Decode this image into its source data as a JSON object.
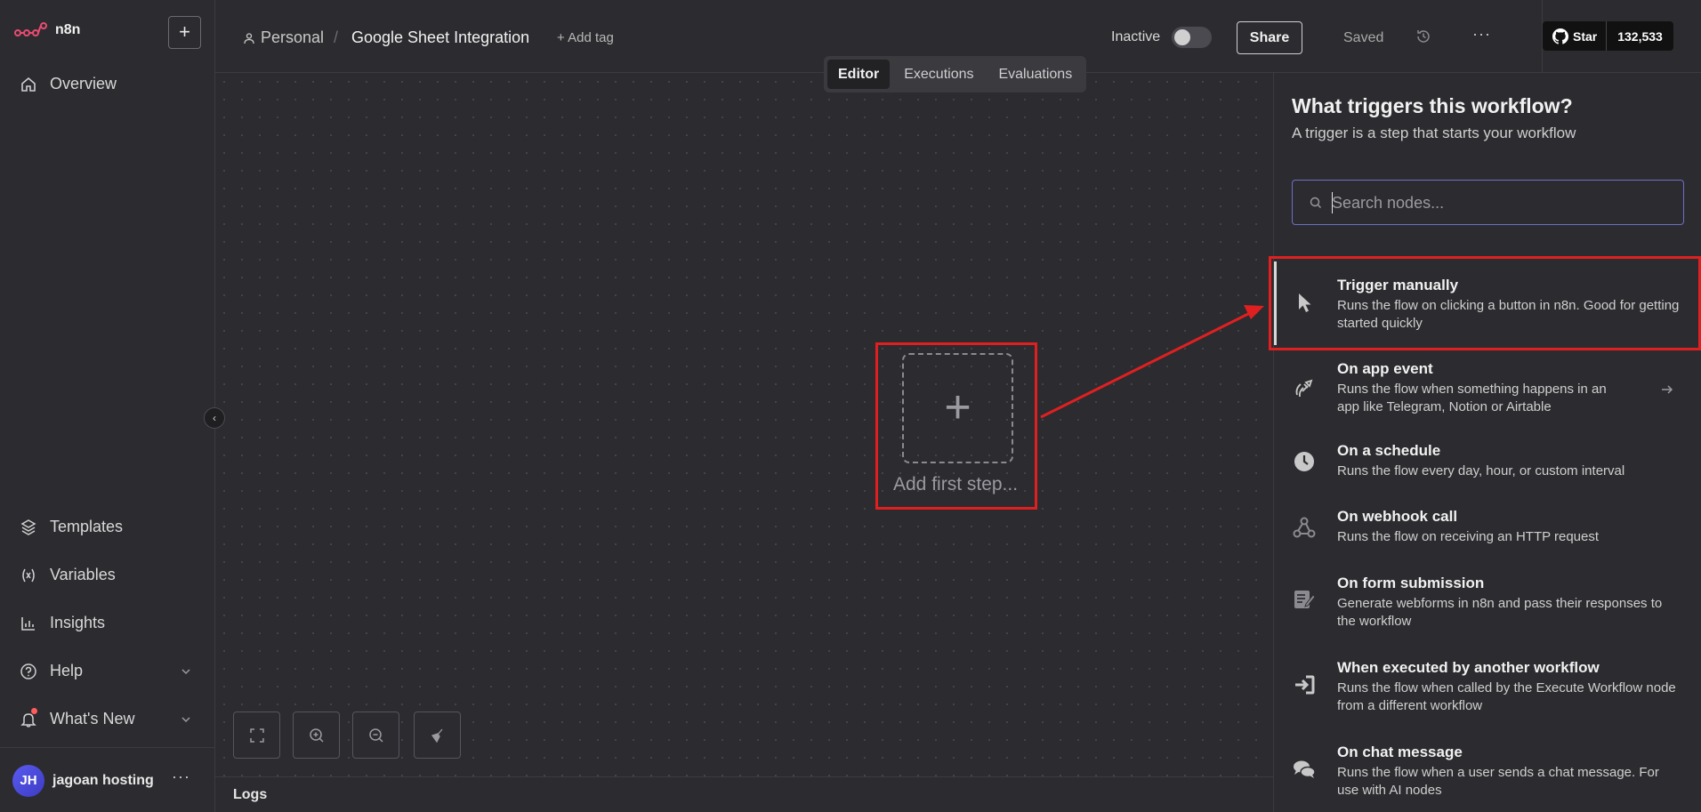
{
  "app": {
    "logo_text": "n8n",
    "new_button": "+"
  },
  "sidebar": {
    "items": [
      {
        "label": "Overview",
        "icon": "home-icon"
      },
      {
        "label": "Templates",
        "icon": "templates-icon"
      },
      {
        "label": "Variables",
        "icon": "variables-icon"
      },
      {
        "label": "Insights",
        "icon": "insights-icon"
      },
      {
        "label": "Help",
        "icon": "help-icon"
      },
      {
        "label": "What's New",
        "icon": "bell-icon"
      }
    ],
    "collapse_glyph": "‹",
    "user": {
      "initials": "JH",
      "name": "jagoan hosting",
      "more": "···"
    }
  },
  "header": {
    "breadcrumb_project": "Personal",
    "breadcrumb_sep": "/",
    "workflow_title": "Google Sheet Integration",
    "add_tag": "+ Add tag",
    "active_label": "Inactive",
    "share": "Share",
    "saved": "Saved",
    "more": "···",
    "github_star": "Star",
    "github_count": "132,533"
  },
  "view_tabs": [
    "Editor",
    "Executions",
    "Evaluations"
  ],
  "canvas": {
    "add_first_step": "Add first step...",
    "plus": "+"
  },
  "logs": {
    "label": "Logs"
  },
  "panel": {
    "title": "What triggers this workflow?",
    "subtitle": "A trigger is a step that starts your workflow",
    "search_placeholder": "Search nodes...",
    "triggers": [
      {
        "title": "Trigger manually",
        "desc": "Runs the flow on clicking a button in n8n. Good for getting started quickly",
        "icon": "cursor-icon"
      },
      {
        "title": "On app event",
        "desc": "Runs the flow when something happens in an app like Telegram, Notion or Airtable",
        "icon": "satellite-icon"
      },
      {
        "title": "On a schedule",
        "desc": "Runs the flow every day, hour, or custom interval",
        "icon": "clock-icon"
      },
      {
        "title": "On webhook call",
        "desc": "Runs the flow on receiving an HTTP request",
        "icon": "webhook-icon"
      },
      {
        "title": "On form submission",
        "desc": "Generate webforms in n8n and pass their responses to the workflow",
        "icon": "form-icon"
      },
      {
        "title": "When executed by another workflow",
        "desc": "Runs the flow when called by the Execute Workflow node from a different workflow",
        "icon": "sign-in-icon"
      },
      {
        "title": "On chat message",
        "desc": "Runs the flow when a user sends a chat message. For use with AI nodes",
        "icon": "chat-icon"
      }
    ]
  },
  "colors": {
    "accent": "#6e6ec8",
    "annotation": "#e02020",
    "brand": "#ea4b71"
  }
}
